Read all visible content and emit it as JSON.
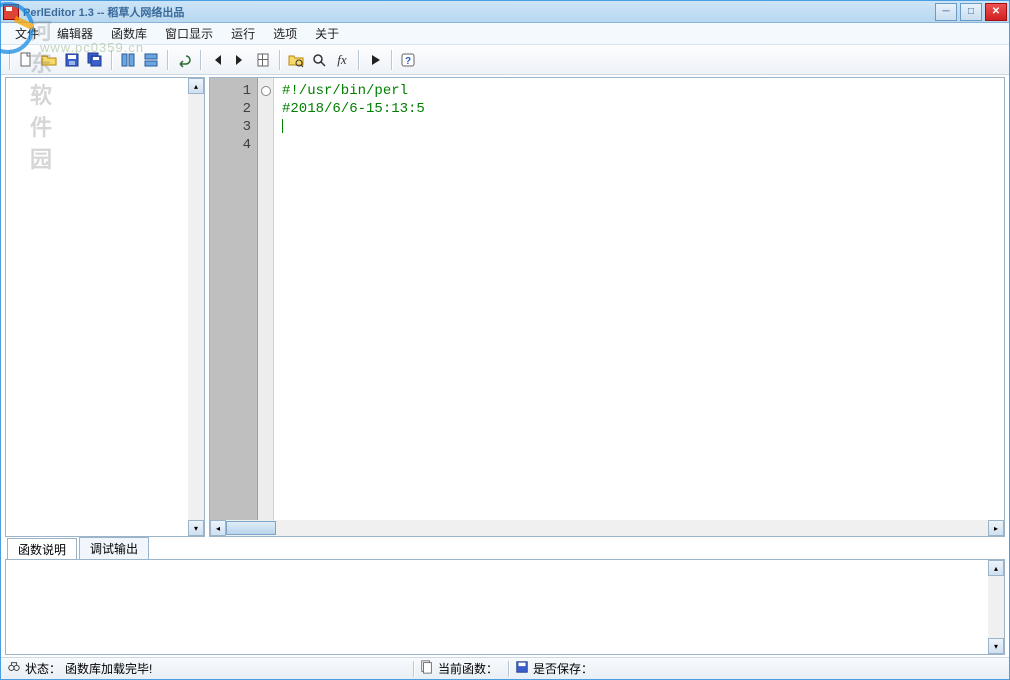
{
  "title": "PerlEditor 1.3 -- 稻草人网络出品",
  "watermark": {
    "text": "河东软件园",
    "sub": "www.pc0359.cn"
  },
  "menu": {
    "file": "文件",
    "editor": "编辑器",
    "funclib": "函数库",
    "window": "窗口显示",
    "run": "运行",
    "options": "选项",
    "about": "关于"
  },
  "toolbar_icons": {
    "new": "new-file-icon",
    "open": "open-folder-icon",
    "save": "save-icon",
    "saveall": "save-all-icon",
    "list1": "list-view-icon",
    "list2": "detail-view-icon",
    "undo": "undo-icon",
    "first": "first-icon",
    "last": "last-icon",
    "bookmark": "bookmark-icon",
    "find": "find-icon",
    "zoom": "zoom-icon",
    "fx": "fx",
    "play": "play-icon",
    "help": "help-icon"
  },
  "code": {
    "lines": [
      {
        "n": "1",
        "text": "#!/usr/bin/perl",
        "mark": false
      },
      {
        "n": "2",
        "text": "#2018/6/6-15:13:5",
        "mark": true
      },
      {
        "n": "3",
        "text": "",
        "mark": false
      },
      {
        "n": "4",
        "text": "",
        "mark": false
      }
    ]
  },
  "bottom_tabs": {
    "t1": "函数说明",
    "t2": "调试输出"
  },
  "status": {
    "label": "状态：",
    "msg": "函数库加载完毕!",
    "current_fn_label": "当前函数：",
    "current_fn": "",
    "saved_label": "是否保存：",
    "saved": ""
  }
}
